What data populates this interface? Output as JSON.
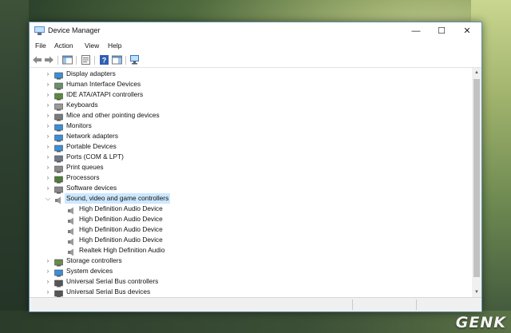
{
  "window": {
    "title": "Device Manager"
  },
  "window_controls": {
    "minimize": "—",
    "maximize": "☐",
    "close": "✕"
  },
  "menu": [
    "File",
    "Action",
    "View",
    "Help"
  ],
  "toolbar": {
    "buttons": [
      "back-icon",
      "forward-icon",
      "show-hide-console-tree-icon",
      "properties-icon",
      "help-icon",
      "show-action-pane-icon",
      "scan-hardware-icon"
    ]
  },
  "device_tree": {
    "categories": [
      {
        "label": "Display adapters",
        "icon": "display-adapter-icon",
        "color": "#3a8fd8",
        "expanded": false
      },
      {
        "label": "Human Interface Devices",
        "icon": "hid-icon",
        "color": "#6b8f6b",
        "expanded": false
      },
      {
        "label": "IDE ATA/ATAPI controllers",
        "icon": "ide-controller-icon",
        "color": "#5a8a3c",
        "expanded": false
      },
      {
        "label": "Keyboards",
        "icon": "keyboard-icon",
        "color": "#9a9a9a",
        "expanded": false
      },
      {
        "label": "Mice and other pointing devices",
        "icon": "mouse-icon",
        "color": "#7a7a7a",
        "expanded": false
      },
      {
        "label": "Monitors",
        "icon": "monitor-icon",
        "color": "#3a8fd8",
        "expanded": false
      },
      {
        "label": "Network adapters",
        "icon": "network-adapter-icon",
        "color": "#3a8fd8",
        "expanded": false
      },
      {
        "label": "Portable Devices",
        "icon": "portable-device-icon",
        "color": "#3a8fd8",
        "expanded": false
      },
      {
        "label": "Ports (COM & LPT)",
        "icon": "port-icon",
        "color": "#6c7a89",
        "expanded": false
      },
      {
        "label": "Print queues",
        "icon": "printer-icon",
        "color": "#8a8a8a",
        "expanded": false
      },
      {
        "label": "Processors",
        "icon": "processor-icon",
        "color": "#4f7d3a",
        "expanded": false
      },
      {
        "label": "Software devices",
        "icon": "software-device-icon",
        "color": "#888888",
        "expanded": false
      },
      {
        "label": "Sound, video and game controllers",
        "icon": "speaker-icon",
        "color": "#8a8a8a",
        "expanded": true,
        "selected": true,
        "children": [
          {
            "label": "High Definition Audio Device",
            "icon": "speaker-icon"
          },
          {
            "label": "High Definition Audio Device",
            "icon": "speaker-icon"
          },
          {
            "label": "High Definition Audio Device",
            "icon": "speaker-icon"
          },
          {
            "label": "High Definition Audio Device",
            "icon": "speaker-icon"
          },
          {
            "label": "Realtek High Definition Audio",
            "icon": "speaker-icon"
          }
        ]
      },
      {
        "label": "Storage controllers",
        "icon": "storage-controller-icon",
        "color": "#6a8a4a",
        "expanded": false
      },
      {
        "label": "System devices",
        "icon": "system-device-icon",
        "color": "#3a8fd8",
        "expanded": false
      },
      {
        "label": "Universal Serial Bus controllers",
        "icon": "usb-icon",
        "color": "#555555",
        "expanded": false
      },
      {
        "label": "Universal Serial Bus devices",
        "icon": "usb-icon",
        "color": "#555555",
        "expanded": false
      }
    ]
  },
  "watermark": {
    "text": "GENK"
  },
  "colors": {
    "selection": "#cce8ff",
    "window_border": "#5f8ea8",
    "accent_blue": "#3a8fd8"
  }
}
